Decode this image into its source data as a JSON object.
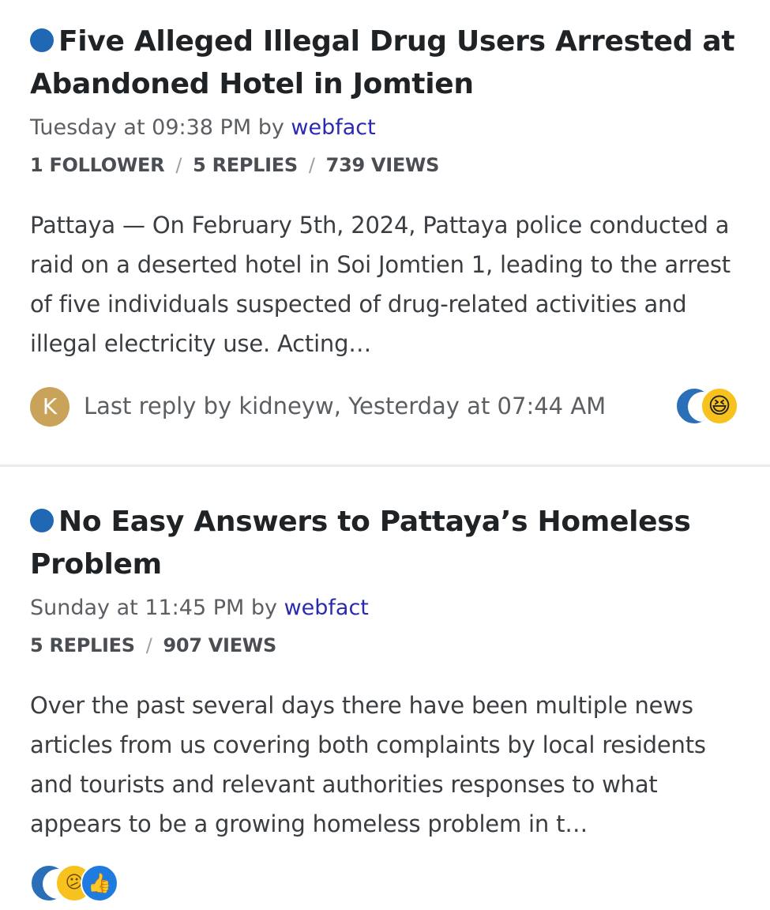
{
  "topics": [
    {
      "title": "Five Alleged Illegal Drug Users Arrested at Abandoned Hotel in Jomtien",
      "date_prefix": "Tuesday at 09:38 PM by ",
      "author": "webfact",
      "stats": [
        "1 FOLLOWER",
        "5 REPLIES",
        "739 VIEWS"
      ],
      "excerpt": "Pattaya — On February 5th, 2024, Pattaya police conducted a raid on a deserted hotel in Soi Jomtien 1, leading to the arrest of five individuals suspected of drug-related activities and illegal electricity use. Acting…",
      "avatar_letter": "K",
      "last_reply": "Last reply by kidneyw, Yesterday at 07:44 AM",
      "reactions": [
        "crescent-icon",
        "laugh-icon"
      ]
    },
    {
      "title": "No Easy Answers to Pattaya’s Homeless Problem",
      "date_prefix": "Sunday at 11:45 PM by ",
      "author": "webfact",
      "stats": [
        "5 REPLIES",
        "907 VIEWS"
      ],
      "excerpt": "Over the past several days there have been multiple news articles from us covering both complaints by local residents and tourists and relevant authorities responses to what appears to be a growing homeless problem in t…",
      "reactions": [
        "crescent-icon",
        "confused-icon",
        "like-icon"
      ]
    }
  ],
  "colors": {
    "unread_dot": "#2067b4",
    "author_link": "#2a2ab0",
    "avatar_bg": "#c9a35a"
  }
}
